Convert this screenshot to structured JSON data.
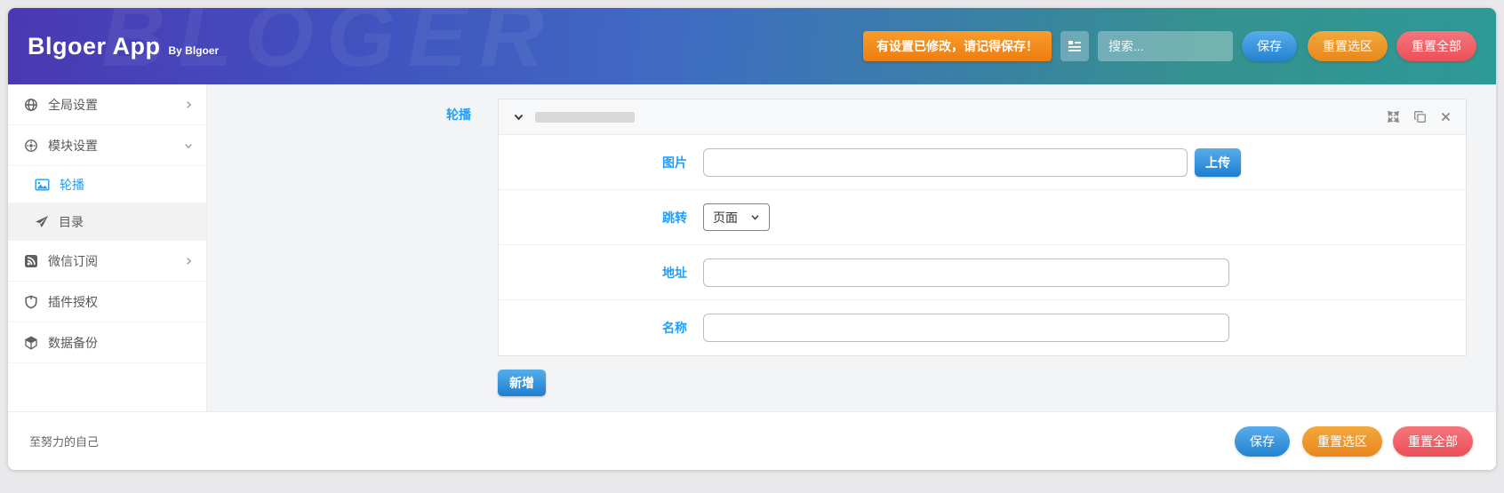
{
  "header": {
    "title": "Blgoer App",
    "subtitle": "By Blgoer",
    "watermark": "BLOGER",
    "notice": "有设置已修改，请记得保存！",
    "search_placeholder": "搜索...",
    "save_label": "保存",
    "reset_selection_label": "重置选区",
    "reset_all_label": "重置全部"
  },
  "sidebar": {
    "items": [
      {
        "label": "全局设置",
        "icon": "globe-icon",
        "chevron": "right"
      },
      {
        "label": "模块设置",
        "icon": "gear-icon",
        "chevron": "down",
        "expanded": true
      },
      {
        "label": "轮播",
        "icon": "image-icon",
        "active": true,
        "submenu": true
      },
      {
        "label": "目录",
        "icon": "paper-plane-icon",
        "submenu": true
      },
      {
        "label": "微信订阅",
        "icon": "rss-icon",
        "chevron": "right"
      },
      {
        "label": "插件授权",
        "icon": "shield-icon"
      },
      {
        "label": "数据备份",
        "icon": "cube-icon"
      }
    ]
  },
  "main": {
    "section_label": "轮播",
    "form": {
      "rows": [
        {
          "label": "图片",
          "value": "",
          "button_label": "上传"
        },
        {
          "label": "跳转",
          "selected_option": "页面"
        },
        {
          "label": "地址",
          "value": ""
        },
        {
          "label": "名称",
          "value": ""
        }
      ]
    },
    "add_button_label": "新增"
  },
  "footer": {
    "text": "至努力的自己",
    "save_label": "保存",
    "reset_selection_label": "重置选区",
    "reset_all_label": "重置全部"
  },
  "colors": {
    "accent_blue": "#1e9fff",
    "header_gradient_start": "#4b38b2",
    "header_gradient_end": "#2e9a97",
    "notice_orange": "#ee7d10",
    "button_blue": "#2383cf",
    "button_orange": "#e8871c",
    "button_red": "#ec4f58"
  },
  "icons": {
    "header": [
      "list-icon"
    ],
    "sidebar": [
      "globe-icon",
      "gear-icon",
      "image-icon",
      "paper-plane-icon",
      "rss-icon",
      "shield-icon",
      "cube-icon",
      "chevron-right-icon",
      "chevron-down-icon"
    ],
    "panel": [
      "chevron-down-icon",
      "expand-icon",
      "copy-icon",
      "close-icon"
    ]
  }
}
